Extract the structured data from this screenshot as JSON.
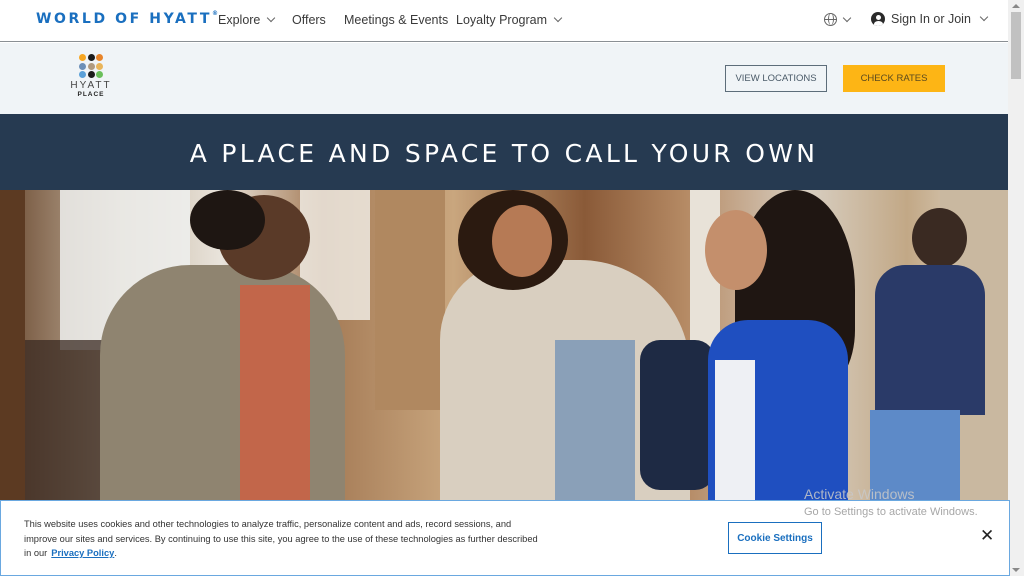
{
  "topnav": {
    "brand": "WORLD OF HYATT",
    "brand_mark": "®",
    "items": [
      {
        "label": "Explore",
        "has_dropdown": true
      },
      {
        "label": "Offers",
        "has_dropdown": false
      },
      {
        "label": "Meetings & Events",
        "has_dropdown": false
      },
      {
        "label": "Loyalty Program",
        "has_dropdown": true
      }
    ],
    "language_icon": "globe-icon",
    "account_label": "Sign In or Join",
    "account_icon": "user-circle-icon"
  },
  "subheader": {
    "logo": {
      "line1": "HYATT",
      "line2": "PLACE",
      "dot_colors": [
        "#f6a623",
        "#1c1c1c",
        "#e8842a",
        "#6c8fb8",
        "#b09a80",
        "#e9b55b",
        "#5aa0d8",
        "#1c1c1c",
        "#6abf5b"
      ]
    },
    "view_locations_label": "VIEW LOCATIONS",
    "check_rates_label": "CHECK RATES"
  },
  "banner": {
    "headline": "A PLACE AND SPACE TO CALL YOUR OWN"
  },
  "hero": {
    "alt": "Friends smiling and chatting in a hotel lobby"
  },
  "cookie_banner": {
    "text": "This website uses cookies and other technologies to analyze traffic, personalize content and ads, record sessions, and improve our sites and services. By continuing to use this site, you agree to the use of these technologies as further described in our",
    "link_label": "Privacy Policy",
    "suffix": ".",
    "settings_label": "Cookie Settings",
    "close_label": "✕"
  },
  "watermark": {
    "title": "Activate Windows",
    "subtitle": "Go to Settings to activate Windows."
  },
  "colors": {
    "brand_blue": "#1a6fbf",
    "banner_navy": "#263a51",
    "cta_yellow": "#fdb515",
    "subheader_bg": "#f0f4f7"
  }
}
